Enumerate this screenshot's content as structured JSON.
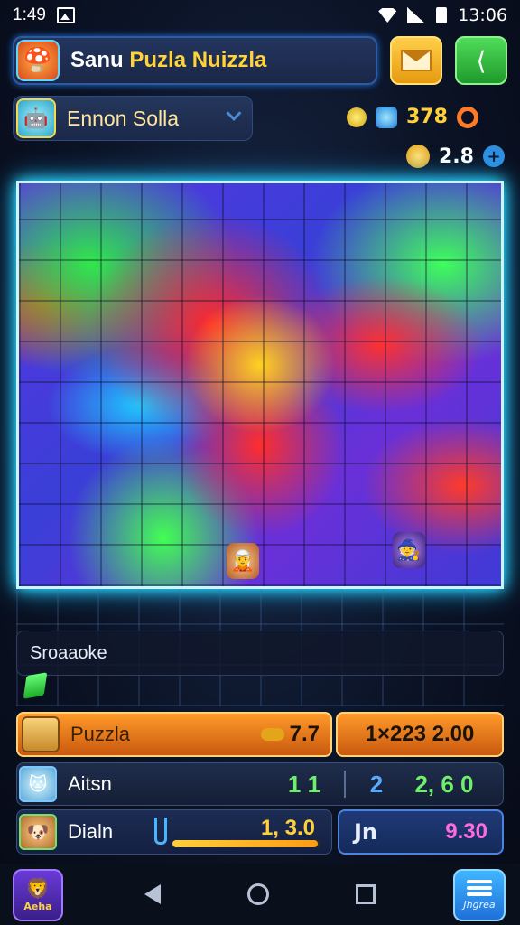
{
  "status_bar": {
    "time": "1:49",
    "clock": "13:06"
  },
  "header": {
    "title_part1": "Sanu",
    "title_part2": "Puzla Nuizzla"
  },
  "user": {
    "name": "Ennon Solla"
  },
  "resources": {
    "gems": "378",
    "stars": "2.8"
  },
  "search": {
    "text": "Sroaaoke"
  },
  "rows": {
    "puzzle": {
      "label": "Puzzla",
      "value": "7.7",
      "side_value": "1×223 2.00"
    },
    "aitsn": {
      "label": "Aitsn",
      "v1": "1 1",
      "v2": "2",
      "v3": "2, 6 0"
    },
    "daln": {
      "label": "Dialn",
      "progress_value": "1, 3.0",
      "progress": 0.98,
      "box_label": "Jn",
      "box_value": "9.30"
    }
  },
  "nav": {
    "left_caption": "Aeha",
    "right_caption": "Jhgrea"
  },
  "colors": {
    "board_border": "#c8f6ff",
    "accent_orange": "#ff9a2a",
    "accent_green": "#4fdc5a"
  }
}
